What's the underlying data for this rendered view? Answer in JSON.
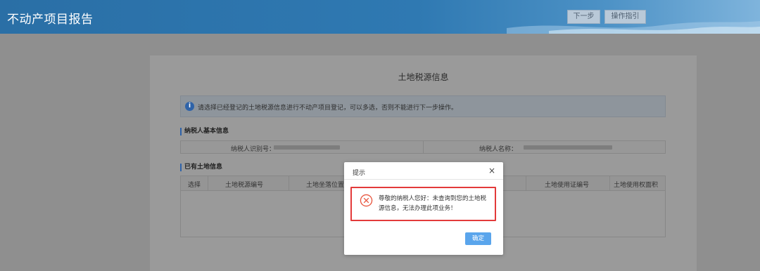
{
  "header": {
    "title": "不动产项目报告",
    "next_button": "下一步",
    "guide_button": "操作指引"
  },
  "panel": {
    "title": "土地税源信息",
    "notice": "请选择已经登记的土地税源信息进行不动产项目登记，可以多选，否则不能进行下一步操作。",
    "taxpayer_section": "纳税人基本信息",
    "taxpayer_id_label": "纳税人识别号：",
    "taxpayer_name_label": "纳税人名称：",
    "land_section": "已有土地信息",
    "columns": [
      "选择",
      "土地税源编号",
      "土地坐落位置",
      "土地使用证编号",
      "土地使用权面积"
    ]
  },
  "dialog": {
    "title": "提示",
    "close": "×",
    "message": "尊敬的纳税人您好：未查询到您的土地税源信息，无法办理此项业务！",
    "ok_button": "确定"
  },
  "colors": {
    "header_blue": "#2f79b2",
    "alert_border": "#e33a3a",
    "error_icon": "#e8553e",
    "ok_button": "#5aa5ec"
  },
  "icons": [
    "info-icon",
    "error-circle-icon",
    "close-icon"
  ]
}
